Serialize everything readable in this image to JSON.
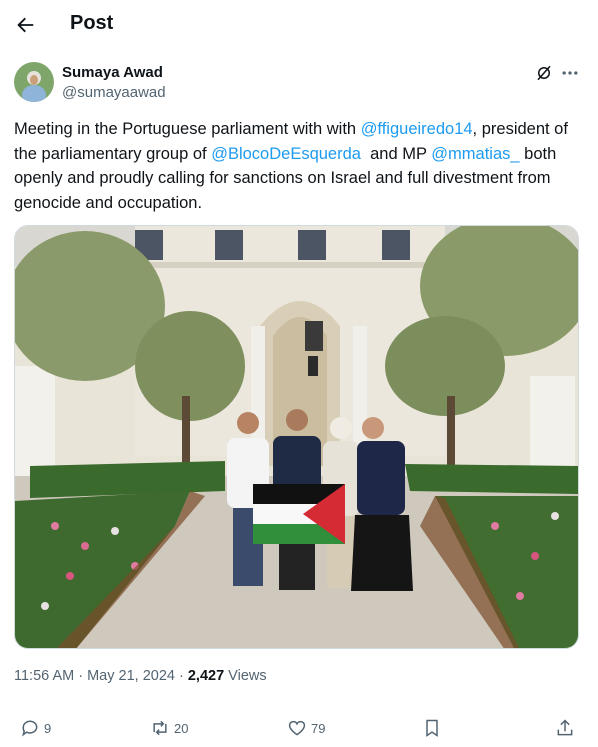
{
  "header": {
    "title": "Post"
  },
  "author": {
    "display_name": "Sumaya Awad",
    "handle": "@sumayaawad"
  },
  "post": {
    "text_1": "Meeting in the Portuguese parliament with with ",
    "mention_1": "@ffigueiredo14",
    "text_2": ", president of the parliamentary group of ",
    "mention_2": "@BlocoDeEsquerda",
    "text_3": "  and MP ",
    "mention_3": "@mmatias_",
    "text_4": " both openly and proudly calling for sanctions on Israel and full divestment from genocide and occupation."
  },
  "meta": {
    "time": "11:56 AM",
    "sep": " · ",
    "date": "May 21, 2024",
    "sep2": " · ",
    "views_count": "2,427",
    "views_label": " Views"
  },
  "actions": {
    "replies": "9",
    "reposts": "20",
    "likes": "79"
  },
  "icons": [
    "back-arrow-icon",
    "grok-icon",
    "more-icon",
    "reply-icon",
    "repost-icon",
    "like-icon",
    "bookmark-icon",
    "share-icon"
  ],
  "colors": {
    "link": "#1d9bf0",
    "muted": "#536471",
    "text": "#0f1419"
  }
}
